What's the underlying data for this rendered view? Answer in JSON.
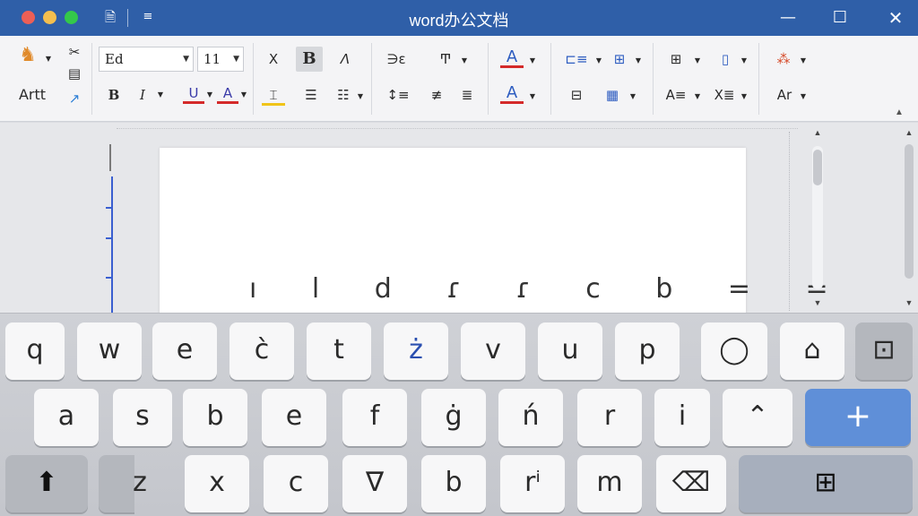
{
  "window": {
    "title": "word办公文档",
    "save_icon": "document-save-icon",
    "menu_icon": "menu-icon",
    "minimize_glyph": "—",
    "maximize_glyph": "☐",
    "close_glyph": "✕"
  },
  "ribbon": {
    "paste_label": "Artt",
    "font_name": "Ed",
    "font_size": "11",
    "bold": "B",
    "italic": "I",
    "underline": "U",
    "font_color": "A",
    "clear_format": "X",
    "strike": "Λ",
    "indent_a": "∋ε",
    "indent_b": "Ͳ",
    "text_fill": "A",
    "text_highlight": "A",
    "styles_a": "A≡",
    "styles_b": "X≣",
    "text_effects": "Ar"
  },
  "document": {
    "visible_text": "ı l d ɾ ɾ c b = ="
  },
  "keyboard": {
    "row1": [
      "q",
      "w",
      "e",
      "c̀",
      "t",
      "ż",
      "v",
      "u",
      "p",
      "◯",
      "⊡"
    ],
    "row2": [
      "a",
      "s",
      "b",
      "e",
      "f",
      "ġ",
      "ń",
      "r",
      "i",
      "⌃",
      "+"
    ],
    "row3": [
      "⬆",
      "",
      "z",
      "x",
      "c",
      "∇",
      "b",
      "rⁱ",
      "m",
      "⌫",
      "⊞"
    ]
  },
  "colors": {
    "titlebar": "#2f5fa8",
    "accent_red": "#d42a2a",
    "accent_yellow": "#f0c419",
    "key_blue": "#5f8fd8"
  }
}
